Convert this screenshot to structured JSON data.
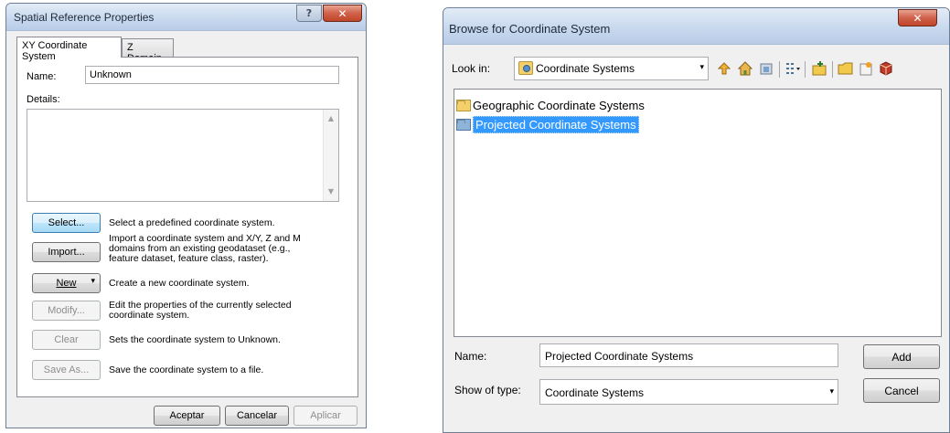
{
  "spatial_dialog": {
    "title": "Spatial Reference Properties",
    "help_glyph": "?",
    "close_glyph": "✕",
    "tabs": [
      "XY Coordinate System",
      "Z Domain"
    ],
    "name_label": "Name:",
    "name_value": "Unknown",
    "details_label": "Details:",
    "details_value": "",
    "scroll_up": "▲",
    "scroll_down": "▼",
    "actions": [
      {
        "label": "Select...",
        "desc": "Select a predefined coordinate system."
      },
      {
        "label": "Import...",
        "desc": "Import a coordinate system and X/Y, Z and M domains from an existing geodataset (e.g., feature dataset, feature class, raster)."
      },
      {
        "label": "New",
        "desc": "Create a new coordinate system."
      },
      {
        "label": "Modify...",
        "desc": "Edit the properties of the currently selected coordinate system."
      },
      {
        "label": "Clear",
        "desc": "Sets the coordinate system to Unknown."
      },
      {
        "label": "Save As...",
        "desc": "Save the coordinate system to a file."
      }
    ],
    "new_arrow": "▾",
    "footer": {
      "ok": "Aceptar",
      "cancel": "Cancelar",
      "apply": "Aplicar"
    }
  },
  "browse_dialog": {
    "title": "Browse for Coordinate System",
    "close_glyph": "✕",
    "look_in_label": "Look in:",
    "look_in_value": "Coordinate Systems",
    "combo_arrow": "▾",
    "toolbar_icons": [
      "up-one-level-icon",
      "home-icon",
      "connect-folder-icon",
      "view-menu-icon",
      "new-folder-icon",
      "folder-icon",
      "new-item-icon",
      "database-icon"
    ],
    "items": [
      {
        "label": "Geographic Coordinate Systems",
        "selected": false
      },
      {
        "label": "Projected Coordinate Systems",
        "selected": true
      }
    ],
    "name_label": "Name:",
    "name_value": "Projected Coordinate Systems",
    "type_label": "Show of type:",
    "type_value": "Coordinate Systems",
    "add_label": "Add",
    "cancel_label": "Cancel"
  },
  "colors": {
    "selection": "#3399ff",
    "folder_yellow": "#f4d06a",
    "folder_blue": "#8fb4d9"
  }
}
